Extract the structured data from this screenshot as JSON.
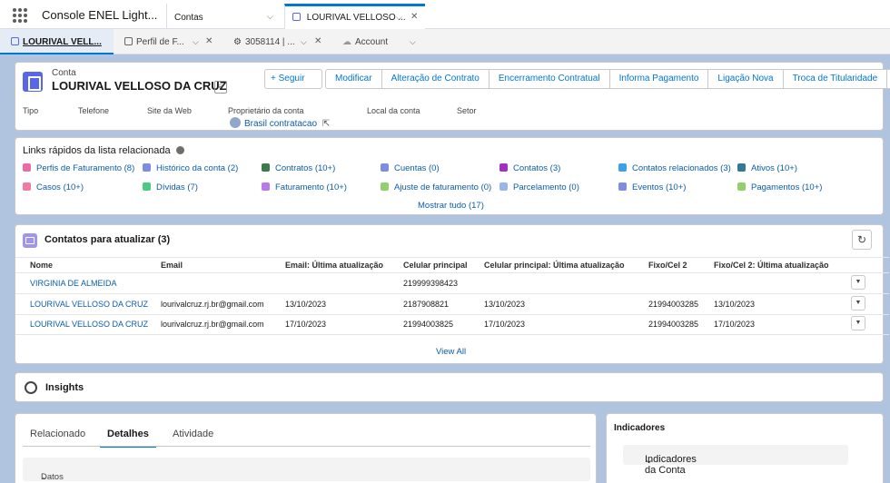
{
  "app": {
    "name": "Console ENEL Light...",
    "tabs": [
      {
        "label": "Contas"
      },
      {
        "label": "LOURIVAL VELLOSO ..."
      }
    ]
  },
  "subtabs": [
    {
      "label": "LOURIVAL VELL..."
    },
    {
      "label": "Perfil de F..."
    },
    {
      "label": "3058114 | ..."
    },
    {
      "label": "Account"
    }
  ],
  "header": {
    "type_label": "Conta",
    "account_name": "LOURIVAL VELLOSO DA CRUZ",
    "follow_label": "Seguir",
    "actions": [
      "Modificar",
      "Alteração de Contrato",
      "Encerramento Contratual",
      "Informa Pagamento",
      "Ligação Nova",
      "Troca de Titularidade"
    ],
    "fields": [
      "Tipo",
      "Telefone",
      "Site da Web",
      "Proprietário da conta",
      "Local da conta",
      "Setor"
    ],
    "owner": "Brasil contratacao"
  },
  "quick_links": {
    "title": "Links rápidos da lista relacionada",
    "items": [
      {
        "label": "Perfis de Faturamento (8)",
        "color": "#e86da6"
      },
      {
        "label": "Histórico da conta (2)",
        "color": "#7f8de1"
      },
      {
        "label": "Contratos (10+)",
        "color": "#3c7a4b"
      },
      {
        "label": "Cuentas (0)",
        "color": "#7f8de1"
      },
      {
        "label": "Contatos (3)",
        "color": "#a030c0"
      },
      {
        "label": "Contatos relacionados (3)",
        "color": "#3ea1e8"
      },
      {
        "label": "Ativos (10+)",
        "color": "#317a92"
      },
      {
        "label": "Casos (10+)",
        "color": "#f27aa0"
      },
      {
        "label": "Dívidas (7)",
        "color": "#4bca81"
      },
      {
        "label": "Faturamento (10+)",
        "color": "#b77ae6"
      },
      {
        "label": "Ajuste de faturamento (0)",
        "color": "#91d06d"
      },
      {
        "label": "Parcelamento (0)",
        "color": "#9ab6e8"
      },
      {
        "label": "Eventos (10+)",
        "color": "#7f8de1"
      },
      {
        "label": "Pagamentos (10+)",
        "color": "#91d06d"
      }
    ],
    "show_all": "Mostrar tudo (17)"
  },
  "contacts": {
    "title": "Contatos para atualizar (3)",
    "columns": [
      "Nome",
      "Email",
      "Email: Última atualização",
      "Celular principal",
      "Celular principal: Última atualização",
      "Fixo/Cel 2",
      "Fixo/Cel 2: Última atualização"
    ],
    "rows": [
      [
        "VIRGINIA DE ALMEIDA",
        "",
        "",
        "219999398423",
        "",
        "",
        ""
      ],
      [
        "LOURIVAL VELLOSO DA CRUZ",
        "lourivalcruz.rj.br@gmail.com",
        "13/10/2023",
        "2187908821",
        "13/10/2023",
        "21994003285",
        "13/10/2023"
      ],
      [
        "LOURIVAL VELLOSO DA CRUZ",
        "lourivalcruz.rj.br@gmail.com",
        "17/10/2023",
        "21994003825",
        "17/10/2023",
        "21994003285",
        "17/10/2023"
      ]
    ],
    "view_all": "View All"
  },
  "insights": {
    "title": "Insights"
  },
  "detail_tabs": {
    "tabs": [
      "Relacionado",
      "Detalhes",
      "Atividade"
    ],
    "section": "Datos Persona"
  },
  "indicators": {
    "title": "Indicadores",
    "section": "Indicadores da Conta"
  }
}
